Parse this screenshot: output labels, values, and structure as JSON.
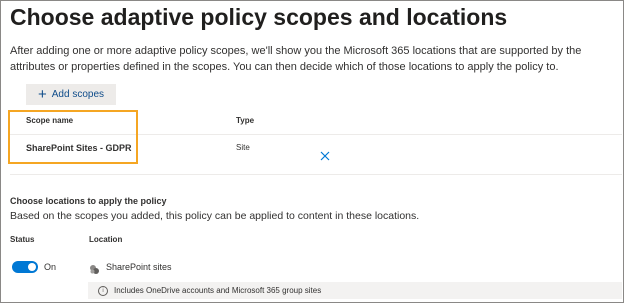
{
  "header": {
    "title": "Choose adaptive policy scopes and locations",
    "description": "After adding one or more adaptive policy scopes, we'll show you the Microsoft 365 locations that are supported by the attributes or properties defined in the scopes. You can then decide which of those locations to apply the policy to."
  },
  "toolbar": {
    "add_scopes_label": "Add scopes"
  },
  "scope_table": {
    "col_name": "Scope name",
    "col_type": "Type",
    "rows": [
      {
        "name": "SharePoint Sites - GDPR",
        "type": "Site"
      }
    ]
  },
  "locations": {
    "title": "Choose locations to apply the policy",
    "description": "Based on the scopes you added, this policy can be applied to content in these locations.",
    "col_status": "Status",
    "col_location": "Location",
    "items": [
      {
        "status": "On",
        "name": "SharePoint sites",
        "info": "Includes OneDrive accounts and Microsoft 365 group sites"
      }
    ]
  },
  "colors": {
    "accent": "#0078d4",
    "highlight": "#f5a623",
    "link": "#0f4c8a"
  },
  "icons": {
    "add": "plus-icon",
    "remove": "close-icon",
    "location": "sharepoint-icon",
    "info": "info-icon"
  }
}
